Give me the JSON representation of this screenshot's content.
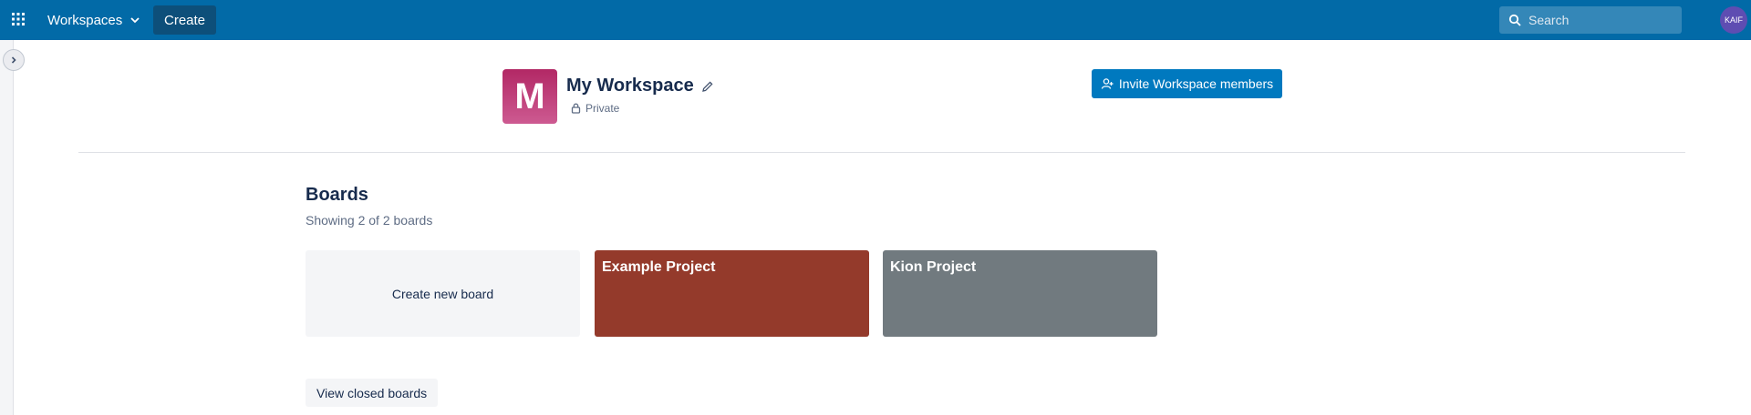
{
  "header": {
    "apps_icon": "grid-icon",
    "workspaces_label": "Workspaces",
    "create_label": "Create",
    "search_placeholder": "Search",
    "avatar_initials": "KAIF"
  },
  "workspace": {
    "logo_letter": "M",
    "name": "My Workspace",
    "visibility": "Private",
    "invite_label": "Invite Workspace members"
  },
  "boards": {
    "heading": "Boards",
    "count_text": "Showing 2 of 2 boards",
    "create_new_label": "Create new board",
    "items": [
      {
        "name": "Example Project",
        "color": "#943a2b"
      },
      {
        "name": "Kion Project",
        "color": "#717a7f"
      }
    ],
    "view_closed_label": "View closed boards"
  },
  "colors": {
    "topbar": "#026aa7",
    "invite_button": "#0079bf"
  }
}
